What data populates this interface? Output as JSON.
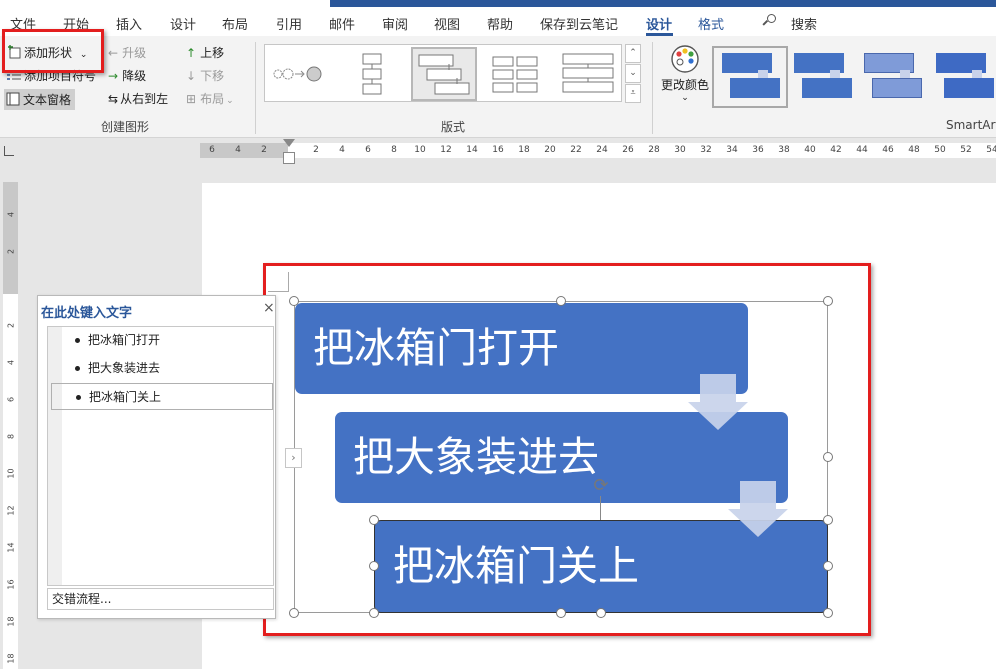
{
  "tabs": [
    {
      "label": "文件"
    },
    {
      "label": "开始"
    },
    {
      "label": "插入"
    },
    {
      "label": "设计"
    },
    {
      "label": "布局"
    },
    {
      "label": "引用"
    },
    {
      "label": "邮件"
    },
    {
      "label": "审阅"
    },
    {
      "label": "视图"
    },
    {
      "label": "帮助"
    },
    {
      "label": "保存到云笔记"
    },
    {
      "label": "设计"
    },
    {
      "label": "格式"
    }
  ],
  "search_label": "搜索",
  "ribbon": {
    "create_graphic": {
      "add_shape": "添加形状",
      "add_bullet": "添加项目符号",
      "text_pane": "文本窗格",
      "promote": "升级",
      "demote": "降级",
      "right_to_left": "从右到左",
      "move_up": "上移",
      "move_down": "下移",
      "layout": "布局",
      "group_label": "创建图形"
    },
    "layouts_group_label": "版式",
    "change_colors": "更改颜色",
    "smartart_styles_label": "SmartArt"
  },
  "ruler": {
    "h_ticks": [
      "6",
      "4",
      "2",
      "",
      "2",
      "4",
      "6",
      "8",
      "10",
      "12",
      "14",
      "16",
      "18",
      "20",
      "22",
      "24",
      "26",
      "28",
      "30",
      "32",
      "34",
      "36",
      "38",
      "40",
      "42",
      "44",
      "46",
      "48",
      "50",
      "52",
      "54"
    ],
    "v_ticks": [
      "4",
      "2",
      "",
      "2",
      "4",
      "6",
      "8",
      "10",
      "12",
      "14",
      "16",
      "18",
      "18"
    ]
  },
  "smartart": {
    "items": [
      "把冰箱门打开",
      "把大象装进去",
      "把冰箱门关上"
    ]
  },
  "text_pane": {
    "title": "在此处键入文字",
    "close": "×",
    "items": [
      "把冰箱门打开",
      "把大象装进去",
      "把冰箱门关上"
    ],
    "footer": "交错流程..."
  },
  "colors": {
    "accent": "#2b579a",
    "smartart_fill": "#4472c4",
    "arrow_fill": "#c8d2ea",
    "highlight": "#e31e1e"
  }
}
